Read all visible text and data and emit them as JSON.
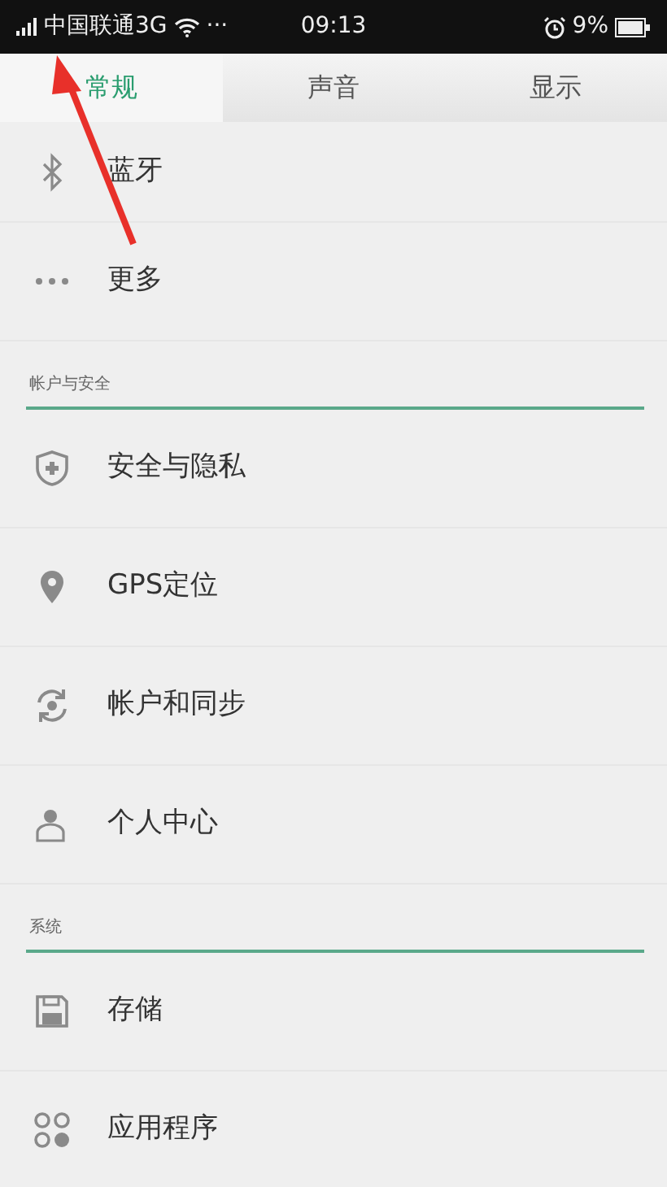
{
  "status_bar": {
    "carrier": "中国联通3G",
    "more": "···",
    "time": "09:13",
    "battery": "9%"
  },
  "tabs": [
    {
      "label": "常规",
      "selected": true
    },
    {
      "label": "声音",
      "selected": false
    },
    {
      "label": "显示",
      "selected": false
    }
  ],
  "groups": [
    {
      "items": [
        {
          "label": "蓝牙"
        },
        {
          "label": "更多"
        }
      ]
    },
    {
      "header": "帐户与安全",
      "items": [
        {
          "label": "安全与隐私"
        },
        {
          "label": "GPS定位"
        },
        {
          "label": "帐户和同步"
        },
        {
          "label": "个人中心"
        }
      ]
    },
    {
      "header": "系统",
      "items": [
        {
          "label": "存储"
        },
        {
          "label": "应用程序"
        }
      ]
    }
  ]
}
